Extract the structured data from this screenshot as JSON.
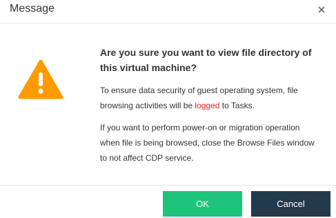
{
  "dialog": {
    "title": "Message",
    "question": "Are you sure you want to view file directory of this virtual machine?",
    "paragraph1": {
      "before": "To ensure data security of guest operating system, file browsing activities will be ",
      "highlight": "logged",
      "after": " to Tasks."
    },
    "paragraph2": "If you want to perform power-on or migration operation when file is being browsed, close the Browse Files window to not affect CDP service.",
    "ok_label": "OK",
    "cancel_label": "Cancel"
  },
  "colors": {
    "warning": "#ff9a00",
    "highlight": "#e02020",
    "ok_button": "#1ec47c",
    "cancel_button": "#223a4c"
  },
  "icons": {
    "close": "close-icon",
    "warning": "warning-icon"
  }
}
